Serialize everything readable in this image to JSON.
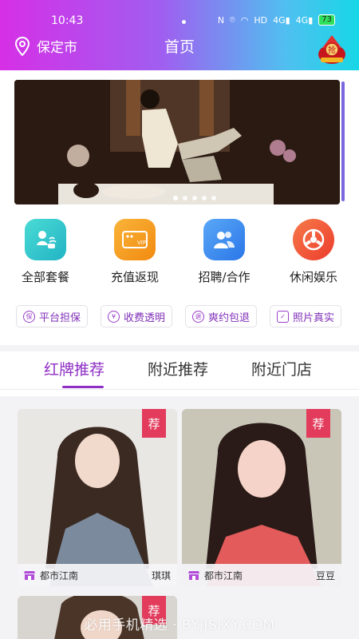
{
  "status": {
    "time": "10:43",
    "net": "4G",
    "battery": "73"
  },
  "header": {
    "city": "保定市",
    "title": "首页",
    "grab_label": "抢"
  },
  "banner": {
    "slides": 5,
    "active": 1
  },
  "quick_actions": [
    {
      "label": "全部套餐",
      "icon": "package-icon",
      "color": "#2ec9c6"
    },
    {
      "label": "充值返现",
      "icon": "vip-card-icon",
      "color": "#f6a21b"
    },
    {
      "label": "招聘/合作",
      "icon": "users-icon",
      "color": "#3f8ff0"
    },
    {
      "label": "休闲娱乐",
      "icon": "aperture-icon",
      "color": "#f05a3a"
    }
  ],
  "tags": [
    {
      "label": "平台担保",
      "icon_text": "保"
    },
    {
      "label": "收费透明",
      "icon_text": "¥"
    },
    {
      "label": "爽约包退",
      "icon_text": "退"
    },
    {
      "label": "照片真实",
      "icon_text": "✓"
    }
  ],
  "tabs": [
    {
      "label": "红牌推荐",
      "active": true
    },
    {
      "label": "附近推荐",
      "active": false
    },
    {
      "label": "附近门店",
      "active": false
    }
  ],
  "cards": [
    {
      "badge": "荐",
      "store": "都市江南",
      "name": "琪琪"
    },
    {
      "badge": "荐",
      "store": "都市江南",
      "name": "豆豆"
    },
    {
      "badge": "荐"
    }
  ],
  "watermark": "必用手机精选 · BYJISIXY.COM",
  "colors": {
    "accent": "#8e2ec4",
    "badge": "#e23b5b"
  }
}
